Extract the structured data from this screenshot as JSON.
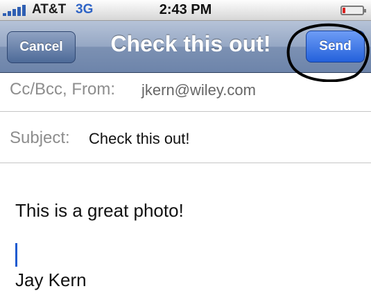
{
  "status_bar": {
    "carrier": "AT&T",
    "network": "3G",
    "time": "2:43 PM",
    "battery_level": 0.15,
    "battery_color": "#d8201f"
  },
  "nav": {
    "title": "Check this out!",
    "cancel_label": "Cancel",
    "send_label": "Send"
  },
  "fields": {
    "cc_label": "Cc/Bcc, From:",
    "from_value": "jkern@wiley.com",
    "subject_label": "Subject:",
    "subject_value": "Check this out!"
  },
  "message": {
    "body": "This is a great photo!",
    "signature": "Jay Kern"
  },
  "icons": [
    "signal-icon",
    "battery-icon",
    "text-cursor-icon"
  ]
}
